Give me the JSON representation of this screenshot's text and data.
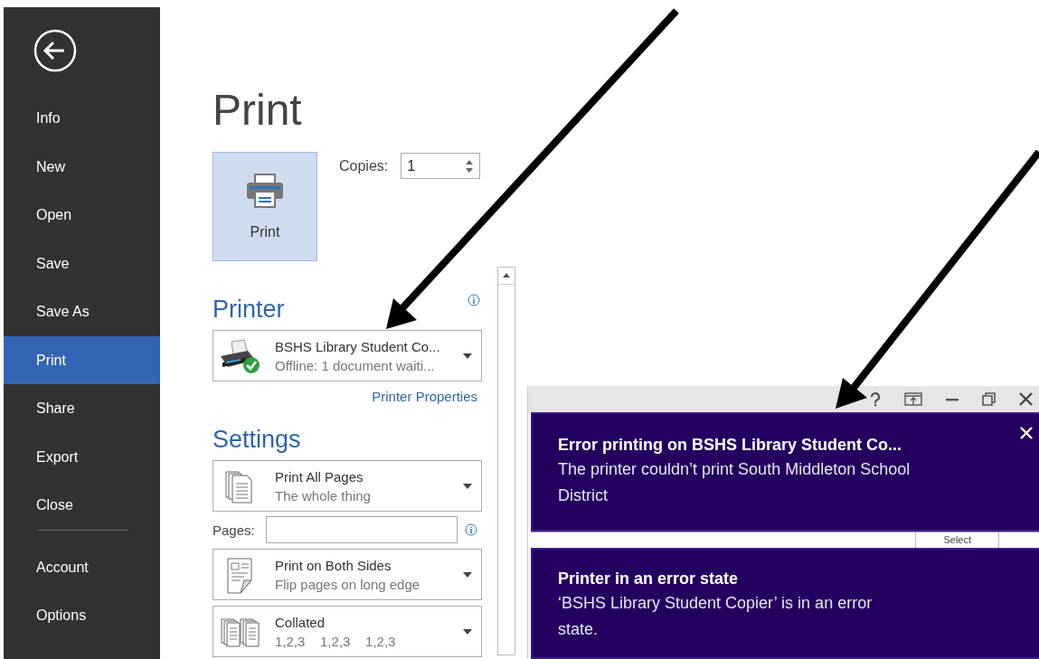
{
  "sidebar": {
    "items": [
      {
        "label": "Info",
        "selected": false
      },
      {
        "label": "New",
        "selected": false
      },
      {
        "label": "Open",
        "selected": false
      },
      {
        "label": "Save",
        "selected": false
      },
      {
        "label": "Save As",
        "selected": false
      },
      {
        "label": "Print",
        "selected": true
      },
      {
        "label": "Share",
        "selected": false
      },
      {
        "label": "Export",
        "selected": false
      },
      {
        "label": "Close",
        "selected": false
      }
    ],
    "footer_items": [
      {
        "label": "Account",
        "selected": false
      },
      {
        "label": "Options",
        "selected": false
      }
    ]
  },
  "page_title": "Print",
  "print_button": {
    "label": "Print"
  },
  "copies": {
    "label": "Copies:",
    "value": "1"
  },
  "printer": {
    "heading": "Printer",
    "name": "BSHS Library Student Co...",
    "status": "Offline: 1 document waiti...",
    "properties_link": "Printer Properties"
  },
  "settings": {
    "heading": "Settings",
    "options": [
      {
        "kind": "pages",
        "title": "Print All Pages",
        "subtitle": "The whole thing"
      },
      {
        "kind": "duplex",
        "title": "Print on Both Sides",
        "subtitle": "Flip pages on long edge"
      },
      {
        "kind": "collate",
        "title": "Collated",
        "subtitle": "1,2,3    1,2,3    1,2,3"
      }
    ],
    "pages_field": {
      "label": "Pages:"
    }
  },
  "background_window": {
    "select_button": "Select"
  },
  "notifications": [
    {
      "title": "Error printing on BSHS Library Student Co...",
      "message": "The printer couldn’t print South Middleton School District",
      "closable": true
    },
    {
      "title": "Printer in an error state",
      "message": "‘BSHS Library Student Copier’ is in an error state.",
      "closable": false
    }
  ]
}
